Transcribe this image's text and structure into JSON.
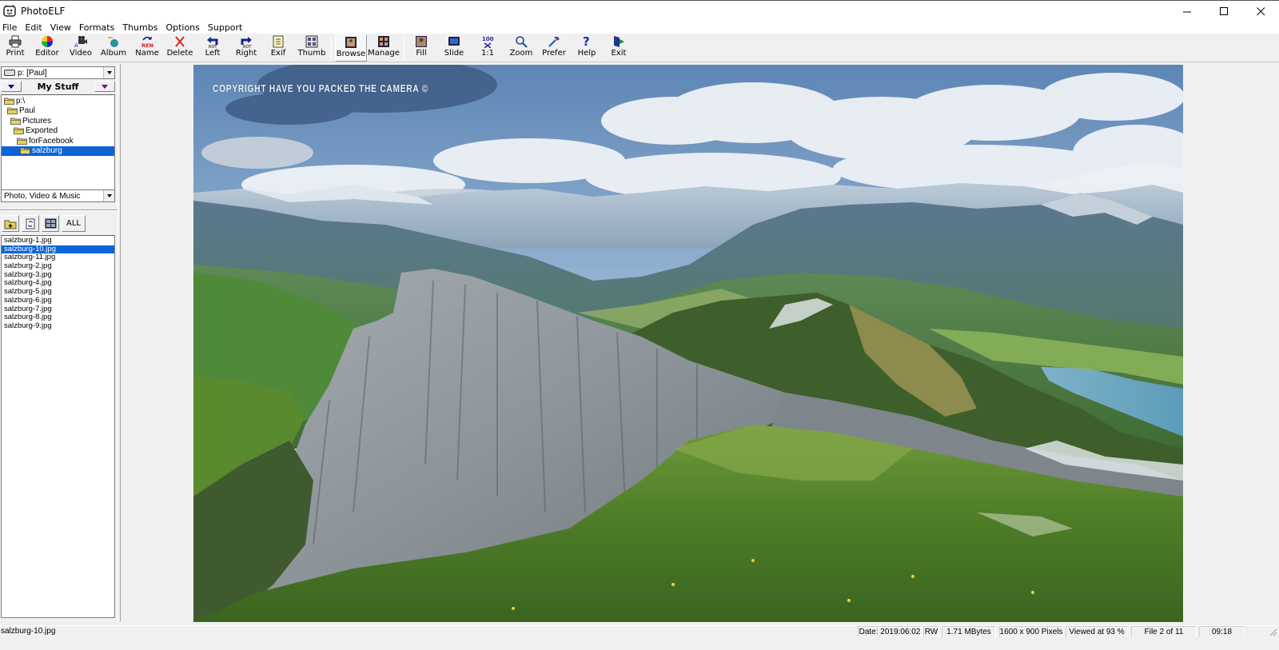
{
  "window": {
    "title": "PhotoELF",
    "controls": [
      "minimize",
      "maximize",
      "close"
    ]
  },
  "menubar": {
    "items": [
      "File",
      "Edit",
      "View",
      "Formats",
      "Thumbs",
      "Options",
      "Support"
    ]
  },
  "toolbar": {
    "buttons": [
      {
        "label": "Print",
        "icon": "printer-icon"
      },
      {
        "label": "Editor",
        "icon": "palette-icon"
      },
      {
        "label": "Video",
        "icon": "video-camera-icon"
      },
      {
        "label": "Album",
        "icon": "album-globe-icon"
      },
      {
        "label": "Name",
        "icon": "rename-icon"
      },
      {
        "label": "Delete",
        "icon": "delete-x-icon"
      },
      {
        "label": "Left",
        "icon": "rotate-left-icon"
      },
      {
        "label": "Right",
        "icon": "rotate-right-icon"
      },
      {
        "label": "Exif",
        "icon": "exif-icon"
      },
      {
        "label": "Thumb",
        "icon": "thumbnail-grid-icon"
      },
      {
        "label": "Browse",
        "icon": "browse-icon",
        "pressed": true
      },
      {
        "label": "Manage",
        "icon": "manage-icon"
      },
      {
        "label": "Fill",
        "icon": "fill-icon"
      },
      {
        "label": "Slide",
        "icon": "slideshow-icon"
      },
      {
        "label": "1:1",
        "icon": "actual-size-icon"
      },
      {
        "label": "Zoom",
        "icon": "magnifier-icon"
      },
      {
        "label": "Prefer",
        "icon": "hammer-icon"
      },
      {
        "label": "Help",
        "icon": "question-icon"
      },
      {
        "label": "Exit",
        "icon": "exit-door-icon"
      }
    ]
  },
  "left_pane": {
    "drive": "p: [Paul]",
    "favorites_label": "My Stuff",
    "folder_tree": [
      {
        "label": "p:\\",
        "depth": 0
      },
      {
        "label": "Paul",
        "depth": 1
      },
      {
        "label": "Pictures",
        "depth": 2
      },
      {
        "label": "Exported",
        "depth": 3
      },
      {
        "label": "forFacebook",
        "depth": 4
      },
      {
        "label": "salzburg",
        "depth": 5,
        "selected": true
      }
    ],
    "filter": "Photo, Video & Music",
    "thumb_tools": [
      "up-folder-icon",
      "refresh-icon",
      "thumbnail-view-icon"
    ],
    "all_label": "ALL",
    "files": [
      {
        "name": "salzburg-1.jpg"
      },
      {
        "name": "salzburg-10.jpg",
        "selected": true
      },
      {
        "name": "salzburg-11.jpg"
      },
      {
        "name": "salzburg-2.jpg"
      },
      {
        "name": "salzburg-3.jpg"
      },
      {
        "name": "salzburg-4.jpg"
      },
      {
        "name": "salzburg-5.jpg"
      },
      {
        "name": "salzburg-6.jpg"
      },
      {
        "name": "salzburg-7.jpg"
      },
      {
        "name": "salzburg-8.jpg"
      },
      {
        "name": "salzburg-9.jpg"
      }
    ]
  },
  "viewer": {
    "watermark": "COPYRIGHT HAVE YOU PACKED THE CAMERA ©",
    "description": "Alpine landscape: limestone cliff ridge, green valleys, snowy peaks, lake, cloudy blue sky"
  },
  "statusbar": {
    "filename": "salzburg-10.jpg",
    "date": "Date: 2019:06:02",
    "access": "RW",
    "size": "1.71 MBytes",
    "dimensions": "1600 x 900 Pixels",
    "viewed_at": "Viewed at  93 %",
    "file_position": "File 2 of 11",
    "time": "09:18"
  }
}
